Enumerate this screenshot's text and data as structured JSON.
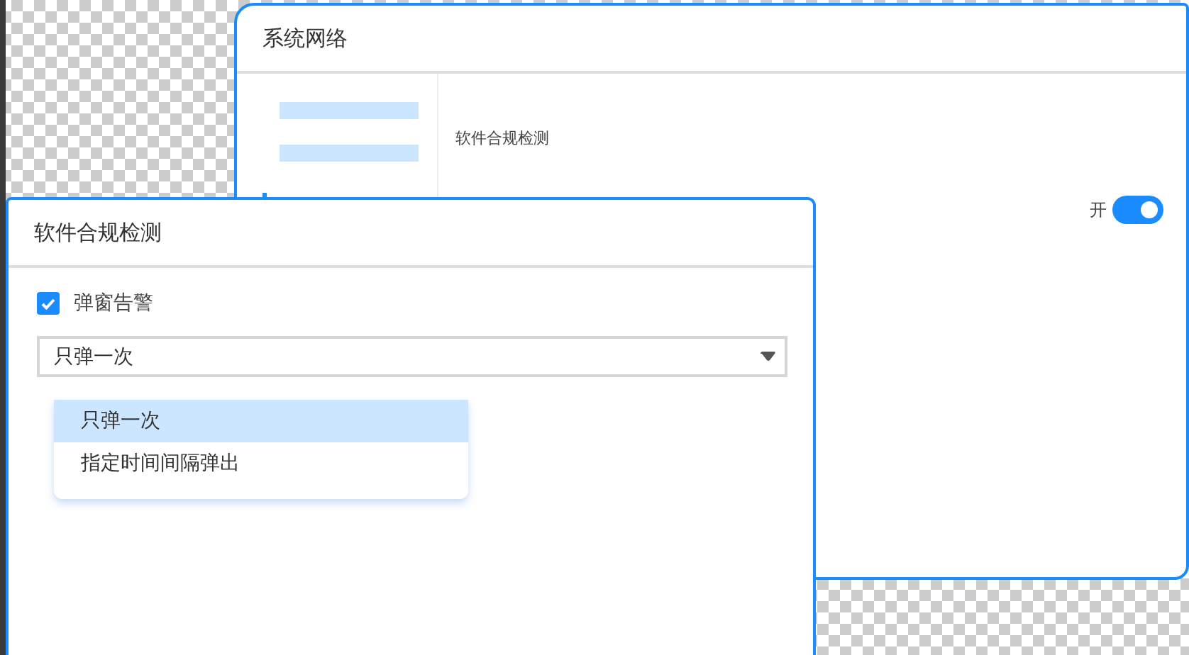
{
  "background_window": {
    "title": "系统网络",
    "setting": {
      "label": "软件合规检测",
      "switch_label": "开",
      "on": true
    }
  },
  "dialog": {
    "title": "软件合规检测",
    "checkbox": {
      "label": "弹窗告警",
      "checked": true
    },
    "select": {
      "value": "只弹一次"
    },
    "options": [
      {
        "label": "只弹一次",
        "selected": true
      },
      {
        "label": "指定时间间隔弹出",
        "selected": false
      }
    ]
  }
}
